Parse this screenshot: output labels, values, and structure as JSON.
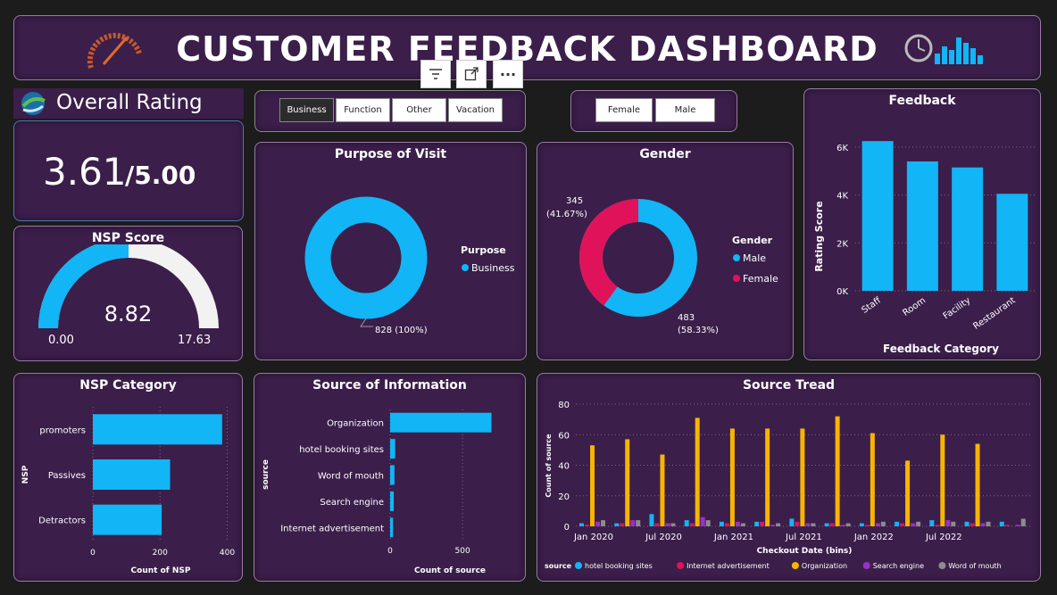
{
  "header": {
    "title": "CUSTOMER FEEDBACK DASHBOARD"
  },
  "visual_toolbar": {
    "more_label": "···"
  },
  "purpose_slicer": {
    "options": [
      "Business",
      "Function",
      "Other",
      "Vacation"
    ],
    "selected": "Business"
  },
  "gender_slicer": {
    "options": [
      "Female",
      "Male"
    ]
  },
  "overall_rating": {
    "title": "Overall Rating",
    "value": "3.61",
    "max": "/5.00"
  },
  "nsp_score": {
    "title": "NSP Score",
    "value": "8.82",
    "min": "0.00",
    "max": "17.63",
    "fraction": 0.5
  },
  "purpose_of_visit": {
    "title": "Purpose of Visit",
    "legend_title": "Purpose",
    "legend_item": "Business",
    "data_label": "828 (100%)"
  },
  "gender": {
    "title": "Gender",
    "legend_title": "Gender",
    "legend": [
      "Male",
      "Female"
    ],
    "label_female_count": "345",
    "label_female_pct": "(41.67%)",
    "label_male_count": "483",
    "label_male_pct": "(58.33%)"
  },
  "feedback": {
    "title": "Feedback",
    "ylabel": "Rating Score",
    "xlabel": "Feedback Category",
    "ticks": [
      "0K",
      "2K",
      "4K",
      "6K"
    ]
  },
  "nsp_category": {
    "title": "NSP Category",
    "ylabel": "NSP",
    "xlabel": "Count of NSP",
    "ticks": [
      "0",
      "200",
      "400"
    ]
  },
  "source_info": {
    "title": "Source of Information",
    "ylabel": "source",
    "xlabel": "Count of source",
    "ticks": [
      "0",
      "500"
    ]
  },
  "source_trend": {
    "title": "Source Tread",
    "ylabel": "Count of source",
    "xlabel": "Checkout Date (bins)",
    "ticks": [
      "0",
      "20",
      "40",
      "60",
      "80"
    ],
    "xticks": [
      "Jan 2020",
      "Jul 2020",
      "Jan 2021",
      "Jul 2021",
      "Jan 2022",
      "Jul 2022"
    ],
    "legend_title": "source"
  },
  "colors": {
    "primary": "#12b5f5",
    "female": "#e0135a",
    "organization": "#f7b500",
    "search": "#9b30c8",
    "word": "#8c8c8c",
    "card": "#3b1e4a"
  },
  "chart_data": [
    {
      "type": "pie",
      "title": "Purpose of Visit",
      "categories": [
        "Business"
      ],
      "values": [
        828
      ]
    },
    {
      "type": "pie",
      "title": "Gender",
      "categories": [
        "Male",
        "Female"
      ],
      "values": [
        483,
        345
      ]
    },
    {
      "type": "bar",
      "title": "Feedback",
      "xlabel": "Feedback Category",
      "ylabel": "Rating Score",
      "categories": [
        "Staff",
        "Room",
        "Facility",
        "Restaurant"
      ],
      "values": [
        6250,
        5400,
        5150,
        4050
      ],
      "ylim": [
        0,
        7000
      ]
    },
    {
      "type": "bar",
      "title": "NSP Category",
      "orientation": "horizontal",
      "xlabel": "Count of NSP",
      "ylabel": "NSP",
      "categories": [
        "promoters",
        "Passives",
        "Detractors"
      ],
      "values": [
        385,
        230,
        205
      ],
      "xlim": [
        0,
        420
      ]
    },
    {
      "type": "bar",
      "title": "Source of Information",
      "orientation": "horizontal",
      "xlabel": "Count of source",
      "ylabel": "source",
      "categories": [
        "Organization",
        "hotel booking sites",
        "Word of mouth",
        "Search engine",
        "Internet advertisement"
      ],
      "values": [
        700,
        35,
        30,
        25,
        20
      ],
      "xlim": [
        0,
        820
      ]
    },
    {
      "type": "bar",
      "title": "Source Tread",
      "xlabel": "Checkout Date (bins)",
      "ylabel": "Count of source",
      "ylim": [
        0,
        80
      ],
      "series": [
        {
          "name": "hotel booking sites",
          "values": [
            2,
            2,
            8,
            4,
            3,
            3,
            5,
            2,
            2,
            3,
            4,
            3,
            3
          ]
        },
        {
          "name": "Internet advertisement",
          "values": [
            1,
            2,
            2,
            2,
            2,
            3,
            3,
            2,
            1,
            2,
            1,
            2,
            1
          ]
        },
        {
          "name": "Organization",
          "values": [
            53,
            57,
            47,
            71,
            64,
            64,
            64,
            72,
            61,
            43,
            60,
            54,
            0
          ]
        },
        {
          "name": "Search engine",
          "values": [
            3,
            4,
            2,
            6,
            3,
            1,
            2,
            1,
            2,
            2,
            4,
            2,
            1
          ]
        },
        {
          "name": "Word of mouth",
          "values": [
            4,
            4,
            2,
            4,
            2,
            2,
            2,
            2,
            3,
            3,
            3,
            3,
            5
          ]
        }
      ]
    }
  ]
}
